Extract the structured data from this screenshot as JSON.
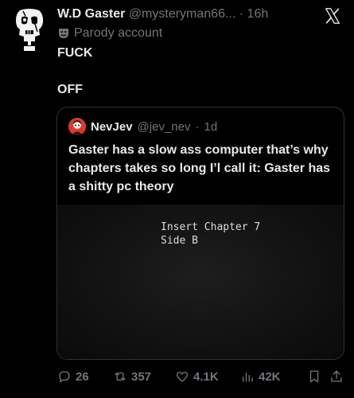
{
  "author": {
    "name": "W.D Gaster",
    "handle": "@mysteryman66...",
    "separator": "·",
    "time": "16h",
    "badge_text": "Parody account"
  },
  "tweet": {
    "line1": "FUCK",
    "line2": "OFF"
  },
  "quote": {
    "name": "NevJev",
    "handle": "@jev_nev",
    "separator": "·",
    "time": "1d",
    "text": "Gaster has a slow ass computer that’s why chapters takes so long I’l call it: Gaster has a shitty pc theory",
    "media_line1": "Insert Chapter 7",
    "media_line2": "Side B"
  },
  "actions": {
    "replies": "26",
    "reposts": "357",
    "likes": "4.1K",
    "views": "42K"
  },
  "icons": {
    "close": "x-logo-icon",
    "badge": "parody-mask-icon",
    "reply": "reply-icon",
    "repost": "repost-icon",
    "like": "like-icon",
    "views": "views-icon",
    "bookmark": "bookmark-icon",
    "share": "share-icon"
  },
  "colors": {
    "background": "#000000",
    "text": "#e7e9ea",
    "muted": "#71767b",
    "border": "#2f3336",
    "quote_avatar": "#d93a2f"
  }
}
